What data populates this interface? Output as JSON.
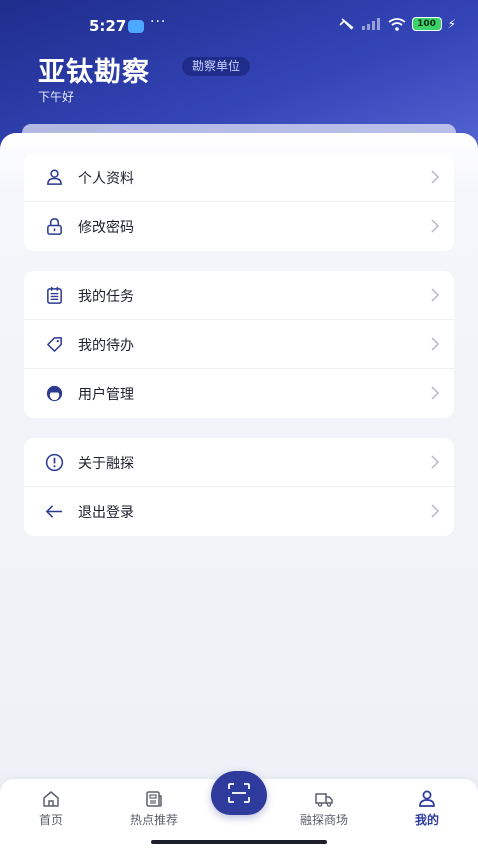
{
  "status_bar": {
    "time": "5:27",
    "dots": "···",
    "battery": "100"
  },
  "header": {
    "title": "亚钛勘察",
    "badge": "勘察单位",
    "greeting": "下午好"
  },
  "menu_groups": [
    {
      "items": [
        {
          "label": "个人资料",
          "icon": "person-icon"
        },
        {
          "label": "修改密码",
          "icon": "lock-icon"
        }
      ]
    },
    {
      "items": [
        {
          "label": "我的任务",
          "icon": "task-list-icon"
        },
        {
          "label": "我的待办",
          "icon": "tag-icon"
        },
        {
          "label": "用户管理",
          "icon": "user-avatar-icon"
        }
      ]
    },
    {
      "items": [
        {
          "label": "关于融探",
          "icon": "info-circle-icon"
        },
        {
          "label": "退出登录",
          "icon": "arrow-left-icon"
        }
      ]
    }
  ],
  "tabbar": {
    "tabs": [
      {
        "label": "首页",
        "icon": "home-icon"
      },
      {
        "label": "热点推荐",
        "icon": "news-icon"
      },
      {
        "label": "融探商场",
        "icon": "truck-icon"
      },
      {
        "label": "我的",
        "icon": "person-icon",
        "active": true
      }
    ],
    "center": {
      "icon": "scan-icon"
    }
  },
  "colors": {
    "primary": "#2f3b9c",
    "icon": "#2c3a8f",
    "chevron": "#b7b9c4"
  }
}
